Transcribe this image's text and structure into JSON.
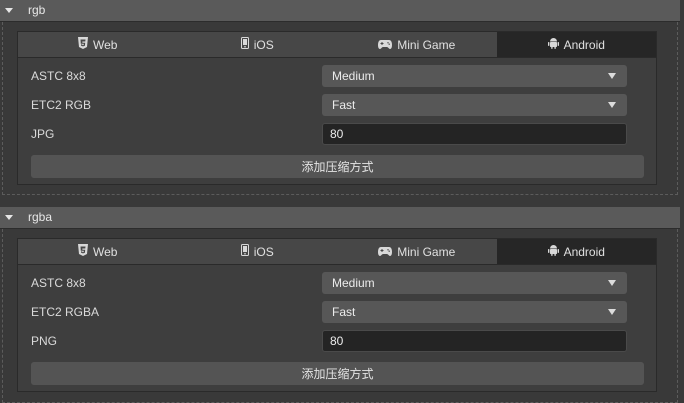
{
  "sections": [
    {
      "title": "rgb",
      "tabs": [
        "Web",
        "iOS",
        "Mini Game",
        "Android"
      ],
      "active_tab": "Android",
      "rows": [
        {
          "label": "ASTC 8x8",
          "type": "select",
          "value": "Medium"
        },
        {
          "label": "ETC2 RGB",
          "type": "select",
          "value": "Fast"
        },
        {
          "label": "JPG",
          "type": "input",
          "value": "80"
        }
      ],
      "add_button": "添加压缩方式"
    },
    {
      "title": "rgba",
      "tabs": [
        "Web",
        "iOS",
        "Mini Game",
        "Android"
      ],
      "active_tab": "Android",
      "rows": [
        {
          "label": "ASTC 8x8",
          "type": "select",
          "value": "Medium"
        },
        {
          "label": "ETC2 RGBA",
          "type": "select",
          "value": "Fast"
        },
        {
          "label": "PNG",
          "type": "input",
          "value": "80"
        }
      ],
      "add_button": "添加压缩方式"
    }
  ],
  "icons": {
    "web": "html5-icon",
    "ios": "phone-icon",
    "minigame": "gamepad-icon",
    "android": "android-icon"
  }
}
